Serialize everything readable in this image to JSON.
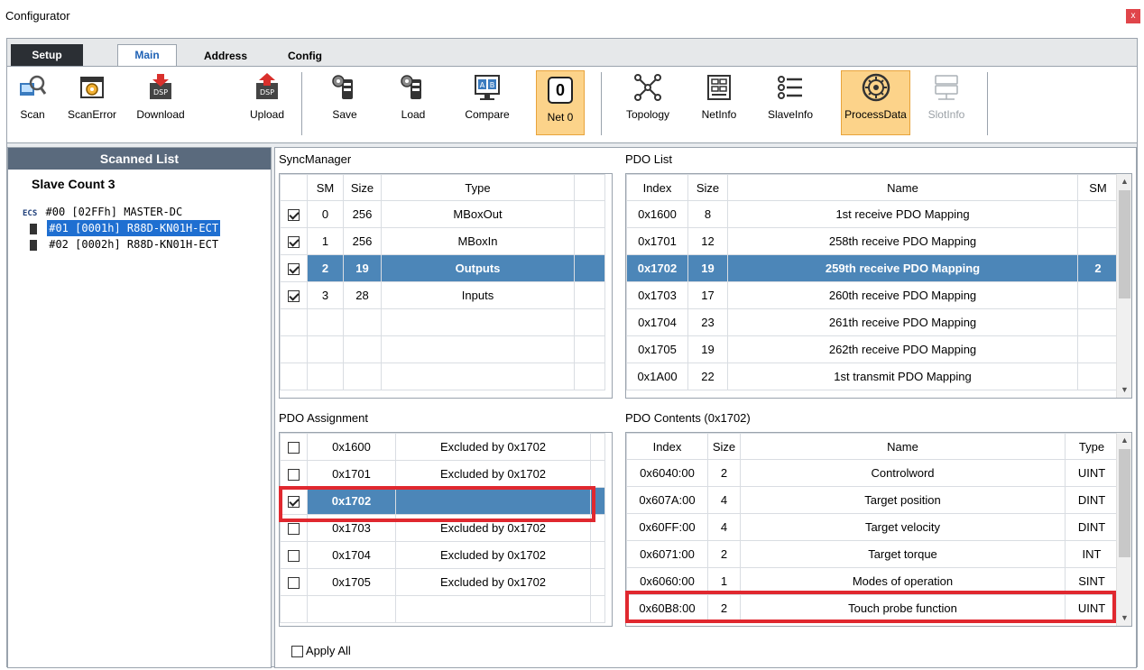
{
  "window": {
    "title": "Configurator",
    "close_glyph": "x"
  },
  "tabs": [
    {
      "label": "Setup"
    },
    {
      "label": "Main"
    },
    {
      "label": "Address"
    },
    {
      "label": "Config"
    }
  ],
  "ribbon": {
    "scan": "Scan",
    "scan_error": "ScanError",
    "download": "Download",
    "upload": "Upload",
    "save": "Save",
    "load": "Load",
    "compare": "Compare",
    "net_number": "0",
    "net_label": "Net 0",
    "topology": "Topology",
    "netinfo": "NetInfo",
    "slaveinfo": "SlaveInfo",
    "processdata": "ProcessData",
    "slotinfo": "SlotInfo",
    "dsp_badge": "DSP",
    "compare_badge_a": "A",
    "compare_badge_b": "B",
    "ecs_badge": "ECS"
  },
  "scanned_list": {
    "header": "Scanned List",
    "slave_count": "Slave Count  3",
    "items": [
      {
        "label": "#00  [02FFh] MASTER-DC"
      },
      {
        "label": "#01  [0001h] R88D-KN01H-ECT"
      },
      {
        "label": "#02  [0002h] R88D-KN01H-ECT"
      }
    ]
  },
  "sync_manager": {
    "label": "SyncManager",
    "headers": [
      "SM",
      "Size",
      "Type"
    ],
    "rows": [
      {
        "sm": "0",
        "size": "256",
        "type": "MBoxOut",
        "checked": true
      },
      {
        "sm": "1",
        "size": "256",
        "type": "MBoxIn",
        "checked": true
      },
      {
        "sm": "2",
        "size": "19",
        "type": "Outputs",
        "checked": true
      },
      {
        "sm": "3",
        "size": "28",
        "type": "Inputs",
        "checked": true
      }
    ]
  },
  "pdo_list": {
    "label": "PDO List",
    "headers": [
      "Index",
      "Size",
      "Name",
      "SM"
    ],
    "rows": [
      {
        "index": "0x1600",
        "size": "8",
        "name": "1st receive PDO Mapping",
        "sm": ""
      },
      {
        "index": "0x1701",
        "size": "12",
        "name": "258th receive PDO Mapping",
        "sm": ""
      },
      {
        "index": "0x1702",
        "size": "19",
        "name": "259th receive PDO Mapping",
        "sm": "2"
      },
      {
        "index": "0x1703",
        "size": "17",
        "name": "260th receive PDO Mapping",
        "sm": ""
      },
      {
        "index": "0x1704",
        "size": "23",
        "name": "261th receive PDO Mapping",
        "sm": ""
      },
      {
        "index": "0x1705",
        "size": "19",
        "name": "262th receive PDO Mapping",
        "sm": ""
      },
      {
        "index": "0x1A00",
        "size": "22",
        "name": "1st transmit PDO Mapping",
        "sm": ""
      }
    ]
  },
  "pdo_assignment": {
    "label": "PDO Assignment",
    "rows": [
      {
        "index": "0x1600",
        "note": "Excluded by 0x1702",
        "checked": false
      },
      {
        "index": "0x1701",
        "note": "Excluded by 0x1702",
        "checked": false
      },
      {
        "index": "0x1702",
        "note": "",
        "checked": true
      },
      {
        "index": "0x1703",
        "note": "Excluded by 0x1702",
        "checked": false
      },
      {
        "index": "0x1704",
        "note": "Excluded by 0x1702",
        "checked": false
      },
      {
        "index": "0x1705",
        "note": "Excluded by 0x1702",
        "checked": false
      }
    ],
    "apply_all": "Apply All"
  },
  "pdo_contents": {
    "label": "PDO Contents (0x1702)",
    "headers": [
      "Index",
      "Size",
      "Name",
      "Type"
    ],
    "rows": [
      {
        "index": "0x6040:00",
        "size": "2",
        "name": "Controlword",
        "type": "UINT"
      },
      {
        "index": "0x607A:00",
        "size": "4",
        "name": "Target position",
        "type": "DINT"
      },
      {
        "index": "0x60FF:00",
        "size": "4",
        "name": "Target velocity",
        "type": "DINT"
      },
      {
        "index": "0x6071:00",
        "size": "2",
        "name": "Target torque",
        "type": "INT"
      },
      {
        "index": "0x6060:00",
        "size": "1",
        "name": "Modes of operation",
        "type": "SINT"
      },
      {
        "index": "0x60B8:00",
        "size": "2",
        "name": "Touch probe function",
        "type": "UINT"
      }
    ]
  },
  "colors": {
    "accent": "#4c86b8",
    "highlight": "#e0282f",
    "active_button": "#fcd38a"
  }
}
